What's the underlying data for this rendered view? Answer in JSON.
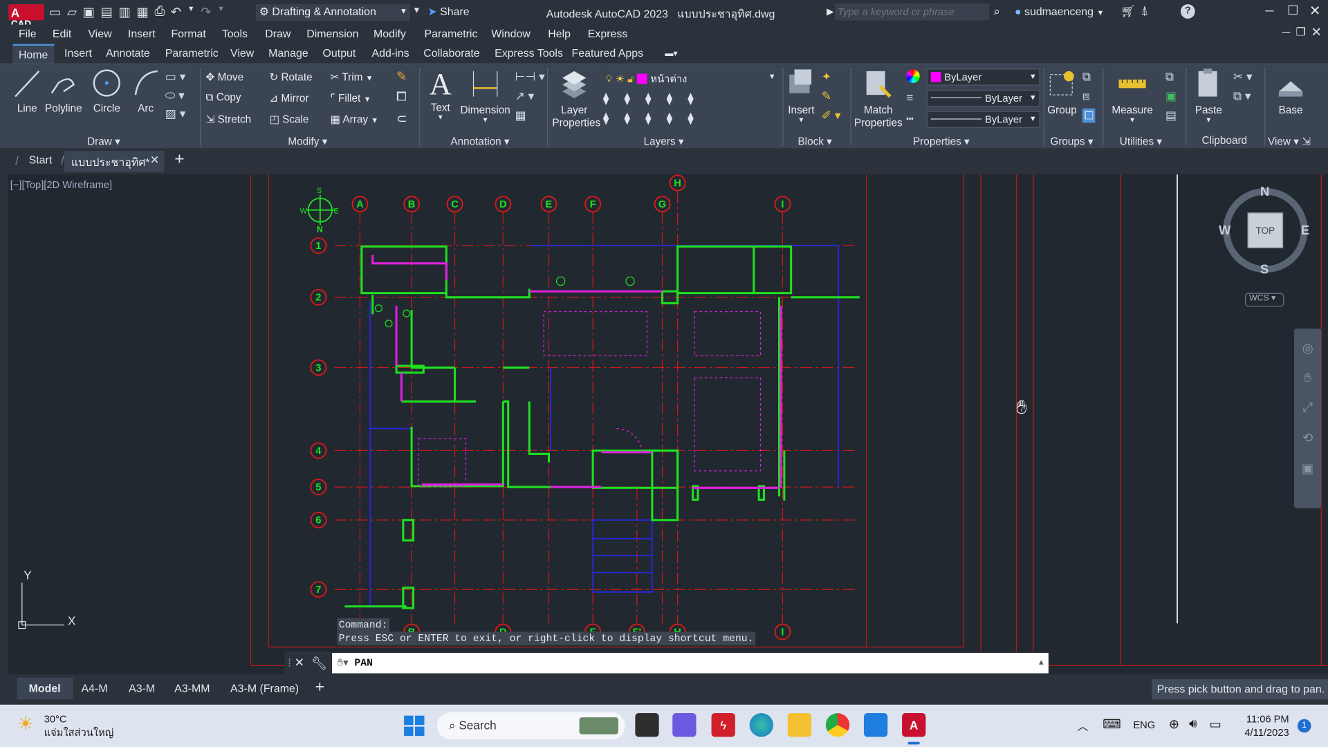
{
  "app": {
    "title": "Autodesk AutoCAD 2023",
    "file": "แบบประชาอุทิศ.dwg",
    "logo_text": "CAD",
    "workspace": "Drafting & Annotation",
    "share": "Share",
    "search_placeholder": "Type a keyword or phrase",
    "user": "sudmaenceng"
  },
  "menu": [
    "File",
    "Edit",
    "View",
    "Insert",
    "Format",
    "Tools",
    "Draw",
    "Dimension",
    "Modify",
    "Parametric",
    "Window",
    "Help",
    "Express"
  ],
  "ribbon_tabs": [
    "Home",
    "Insert",
    "Annotate",
    "Parametric",
    "View",
    "Manage",
    "Output",
    "Add-ins",
    "Collaborate",
    "Express Tools",
    "Featured Apps"
  ],
  "draw": {
    "line": "Line",
    "polyline": "Polyline",
    "circle": "Circle",
    "arc": "Arc",
    "title": "Draw"
  },
  "modify": {
    "move": "Move",
    "rotate": "Rotate",
    "trim": "Trim",
    "copy": "Copy",
    "mirror": "Mirror",
    "fillet": "Fillet",
    "stretch": "Stretch",
    "scale": "Scale",
    "array": "Array",
    "title": "Modify"
  },
  "annotation": {
    "text": "Text",
    "dimension": "Dimension",
    "title": "Annotation"
  },
  "layers": {
    "layer_properties": "Layer Properties",
    "current_layer": "หน้าต่าง",
    "title": "Layers"
  },
  "block": {
    "insert": "Insert",
    "title": "Block"
  },
  "properties": {
    "match": "Match Properties",
    "color": "ByLayer",
    "linetype": "ByLayer",
    "lineweight": "ByLayer",
    "title": "Properties",
    "color_hex": "#ff00ff"
  },
  "groups": {
    "group": "Group",
    "title": "Groups"
  },
  "utilities": {
    "measure": "Measure",
    "title": "Utilities"
  },
  "clipboard": {
    "paste": "Paste",
    "title": "Clipboard"
  },
  "view": {
    "base": "Base",
    "title": "View"
  },
  "doc_tabs": {
    "start": "Start",
    "active": "แบบประชาอุทิศ*"
  },
  "viewport": {
    "label": "[−][Top][2D Wireframe]",
    "top_grid": [
      "A",
      "B",
      "C",
      "D",
      "E",
      "F",
      "G",
      "H",
      "I"
    ],
    "bottom_grid": [
      "B",
      "D",
      "F",
      "F'",
      "H",
      "I"
    ],
    "rows": [
      "1",
      "2",
      "3",
      "4",
      "5",
      "6",
      "7"
    ],
    "viewcube": {
      "top": "TOP",
      "n": "N",
      "s": "S",
      "e": "E",
      "w": "W",
      "wcs": "WCS"
    },
    "ucs_x": "X",
    "ucs_y": "Y",
    "north_s": "S",
    "north_n": "N",
    "north_w": "W",
    "north_e": "E"
  },
  "command": {
    "history1": "Command:",
    "history2": "Press ESC or ENTER to exit, or right-click to display shortcut menu.",
    "input": "PAN"
  },
  "layout_tabs": [
    "Model",
    "A4-M",
    "A3-M",
    "A3-MM",
    "A3-M (Frame)"
  ],
  "status": {
    "hint": "Press pick button and drag to pan."
  },
  "taskbar": {
    "temp": "30°C",
    "weather": "แจ่มใสส่วนใหญ่",
    "search": "Search",
    "lang": "ENG",
    "time": "11:06 PM",
    "date": "4/11/2023",
    "badge": "1"
  }
}
